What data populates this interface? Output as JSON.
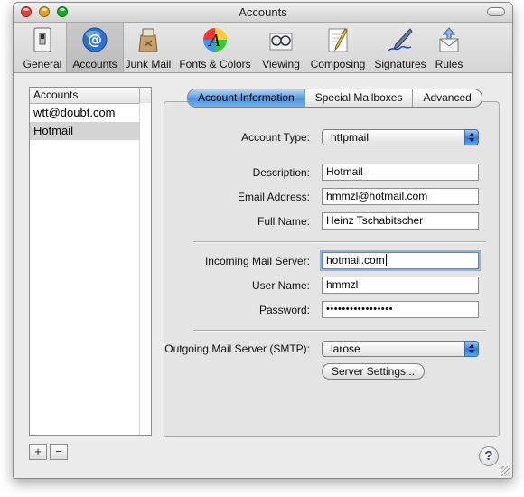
{
  "window": {
    "title": "Accounts"
  },
  "colors": {
    "tl_close": "#e0443e",
    "tl_min": "#dea123",
    "tl_zoom": "#1aab29"
  },
  "toolbar": {
    "items": [
      {
        "label": "General",
        "icon": "light-switch-icon"
      },
      {
        "label": "Accounts",
        "icon": "at-sign-icon",
        "selected": true
      },
      {
        "label": "Junk Mail",
        "icon": "junk-bag-icon"
      },
      {
        "label": "Fonts & Colors",
        "icon": "color-wheel-font-icon"
      },
      {
        "label": "Viewing",
        "icon": "glasses-icon"
      },
      {
        "label": "Composing",
        "icon": "pencil-paper-icon"
      },
      {
        "label": "Signatures",
        "icon": "fountain-pen-icon"
      },
      {
        "label": "Rules",
        "icon": "rules-envelope-icon"
      }
    ]
  },
  "accounts_list": {
    "header": "Accounts",
    "items": [
      {
        "label": "wtt@doubt.com",
        "selected": false
      },
      {
        "label": "Hotmail",
        "selected": true
      }
    ],
    "add_label": "+",
    "remove_label": "−"
  },
  "tabs": [
    {
      "label": "Account Information",
      "active": true
    },
    {
      "label": "Special Mailboxes",
      "active": false
    },
    {
      "label": "Advanced",
      "active": false
    }
  ],
  "form": {
    "account_type": {
      "label": "Account Type:",
      "value": "httpmail"
    },
    "description": {
      "label": "Description:",
      "value": "Hotmail"
    },
    "email": {
      "label": "Email Address:",
      "value": "hmmzl@hotmail.com"
    },
    "full_name": {
      "label": "Full Name:",
      "value": "Heinz Tschabitscher"
    },
    "incoming": {
      "label": "Incoming Mail Server:",
      "value": "hotmail.com"
    },
    "user_name": {
      "label": "User Name:",
      "value": "hmmzl"
    },
    "password": {
      "label": "Password:",
      "value": "•••••••••••••••••"
    },
    "outgoing": {
      "label": "Outgoing Mail Server (SMTP):",
      "value": "larose"
    },
    "server_settings_label": "Server Settings..."
  },
  "help": {
    "label": "?"
  }
}
